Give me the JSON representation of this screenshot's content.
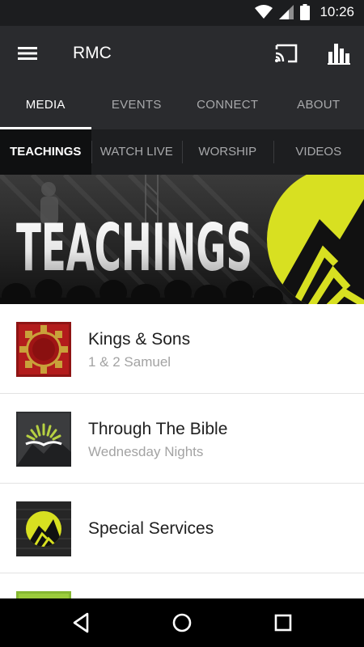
{
  "status_bar": {
    "time": "10:26"
  },
  "app_bar": {
    "title": "RMC"
  },
  "main_tabs": [
    {
      "label": "MEDIA"
    },
    {
      "label": "EVENTS"
    },
    {
      "label": "CONNECT"
    },
    {
      "label": "ABOUT"
    }
  ],
  "sub_tabs": [
    {
      "label": "TEACHINGS"
    },
    {
      "label": "WATCH LIVE"
    },
    {
      "label": "WORSHIP"
    },
    {
      "label": "VIDEOS"
    }
  ],
  "banner": {
    "title": "TEACHINGS"
  },
  "items": [
    {
      "title": "Kings & Sons",
      "subtitle": "1 & 2 Samuel"
    },
    {
      "title": "Through The Bible",
      "subtitle": "Wednesday Nights"
    },
    {
      "title": "Special Services"
    }
  ],
  "colors": {
    "accent_lime": "#d8e021",
    "appbar": "#2a2b2e",
    "subtabbar": "#1d1e20"
  },
  "icons": [
    "wifi-icon",
    "signal-icon",
    "battery-icon",
    "menu-icon",
    "cast-icon",
    "stats-icon",
    "back-icon",
    "home-icon",
    "recents-icon"
  ]
}
